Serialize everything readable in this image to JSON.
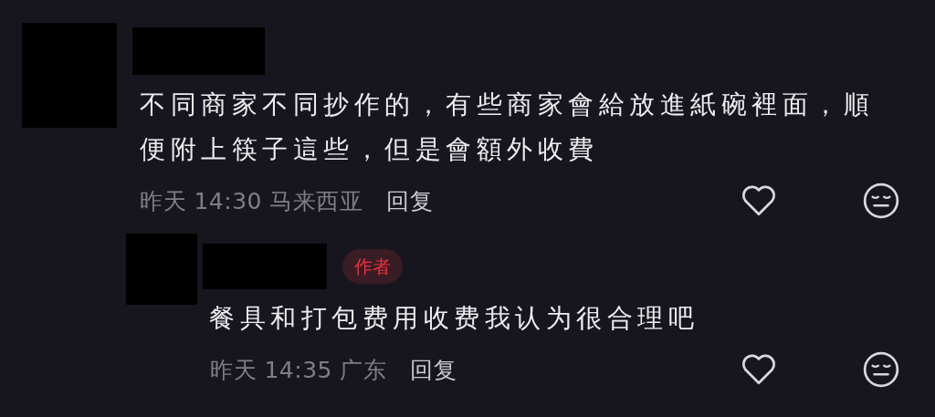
{
  "comments": [
    {
      "text": "不同商家不同抄作的，有些商家會給放進紙碗裡面，順便附上筷子這些，但是會額外收費",
      "time": "昨天 14:30",
      "location": "马来西亚",
      "reply_label": "回复",
      "liked": false,
      "replies": [
        {
          "author_badge": "作者",
          "text": "餐具和打包费用收费我认为很合理吧",
          "time": "昨天 14:35",
          "location": "广东",
          "reply_label": "回复",
          "liked": false
        }
      ]
    }
  ]
}
